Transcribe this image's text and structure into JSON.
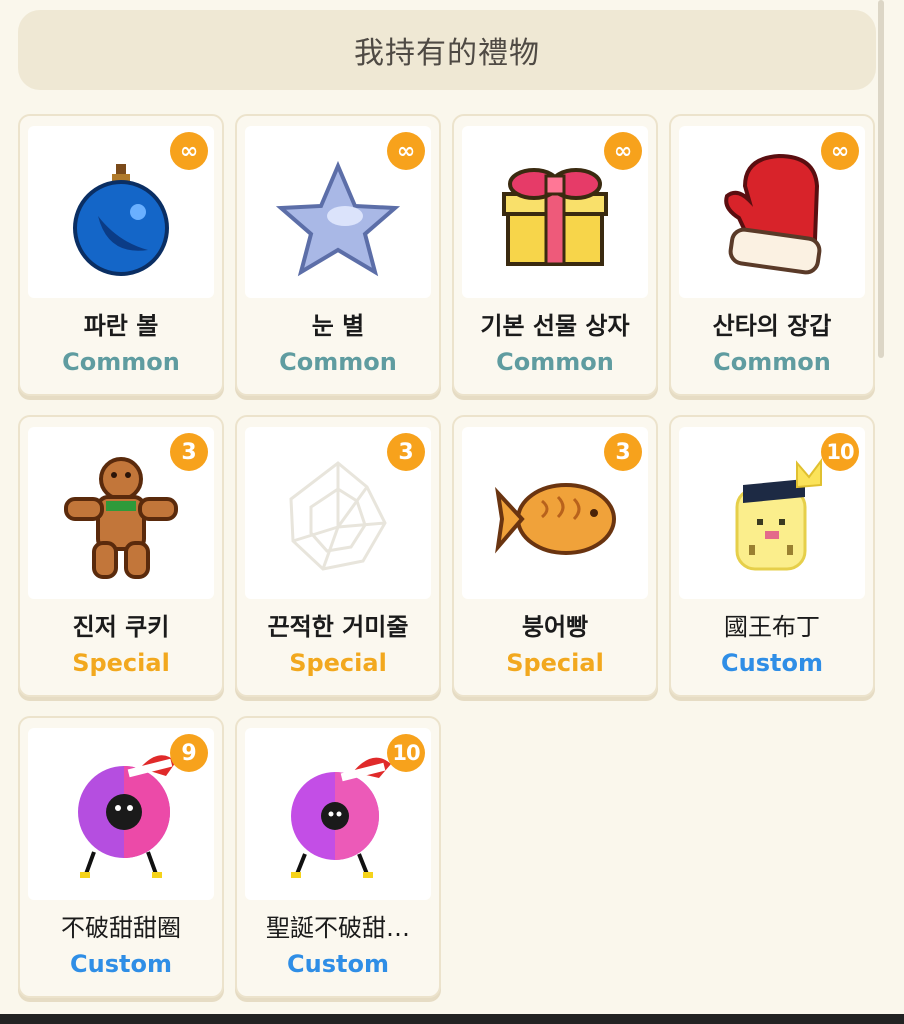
{
  "header": {
    "title": "我持有的禮物"
  },
  "items": [
    {
      "name": "파란 볼",
      "rarity": "Common",
      "count": "∞",
      "icon": "blue-ornament-icon"
    },
    {
      "name": "눈 별",
      "rarity": "Common",
      "count": "∞",
      "icon": "snow-star-icon"
    },
    {
      "name": "기본 선물 상자",
      "rarity": "Common",
      "count": "∞",
      "icon": "gift-box-icon"
    },
    {
      "name": "산타의 장갑",
      "rarity": "Common",
      "count": "∞",
      "icon": "santa-mitten-icon"
    },
    {
      "name": "진저 쿠키",
      "rarity": "Special",
      "count": "3",
      "icon": "gingerbread-cookie-icon"
    },
    {
      "name": "끈적한 거미줄",
      "rarity": "Special",
      "count": "3",
      "icon": "spider-web-icon"
    },
    {
      "name": "붕어빵",
      "rarity": "Special",
      "count": "3",
      "icon": "fish-bread-icon"
    },
    {
      "name": "國王布丁",
      "rarity": "Custom",
      "count": "10",
      "icon": "king-pudding-icon"
    },
    {
      "name": "不破甜甜圈",
      "rarity": "Custom",
      "count": "9",
      "icon": "purple-donut-icon"
    },
    {
      "name": "聖誕不破甜…",
      "rarity": "Custom",
      "count": "10",
      "icon": "christmas-donut-icon"
    }
  ]
}
